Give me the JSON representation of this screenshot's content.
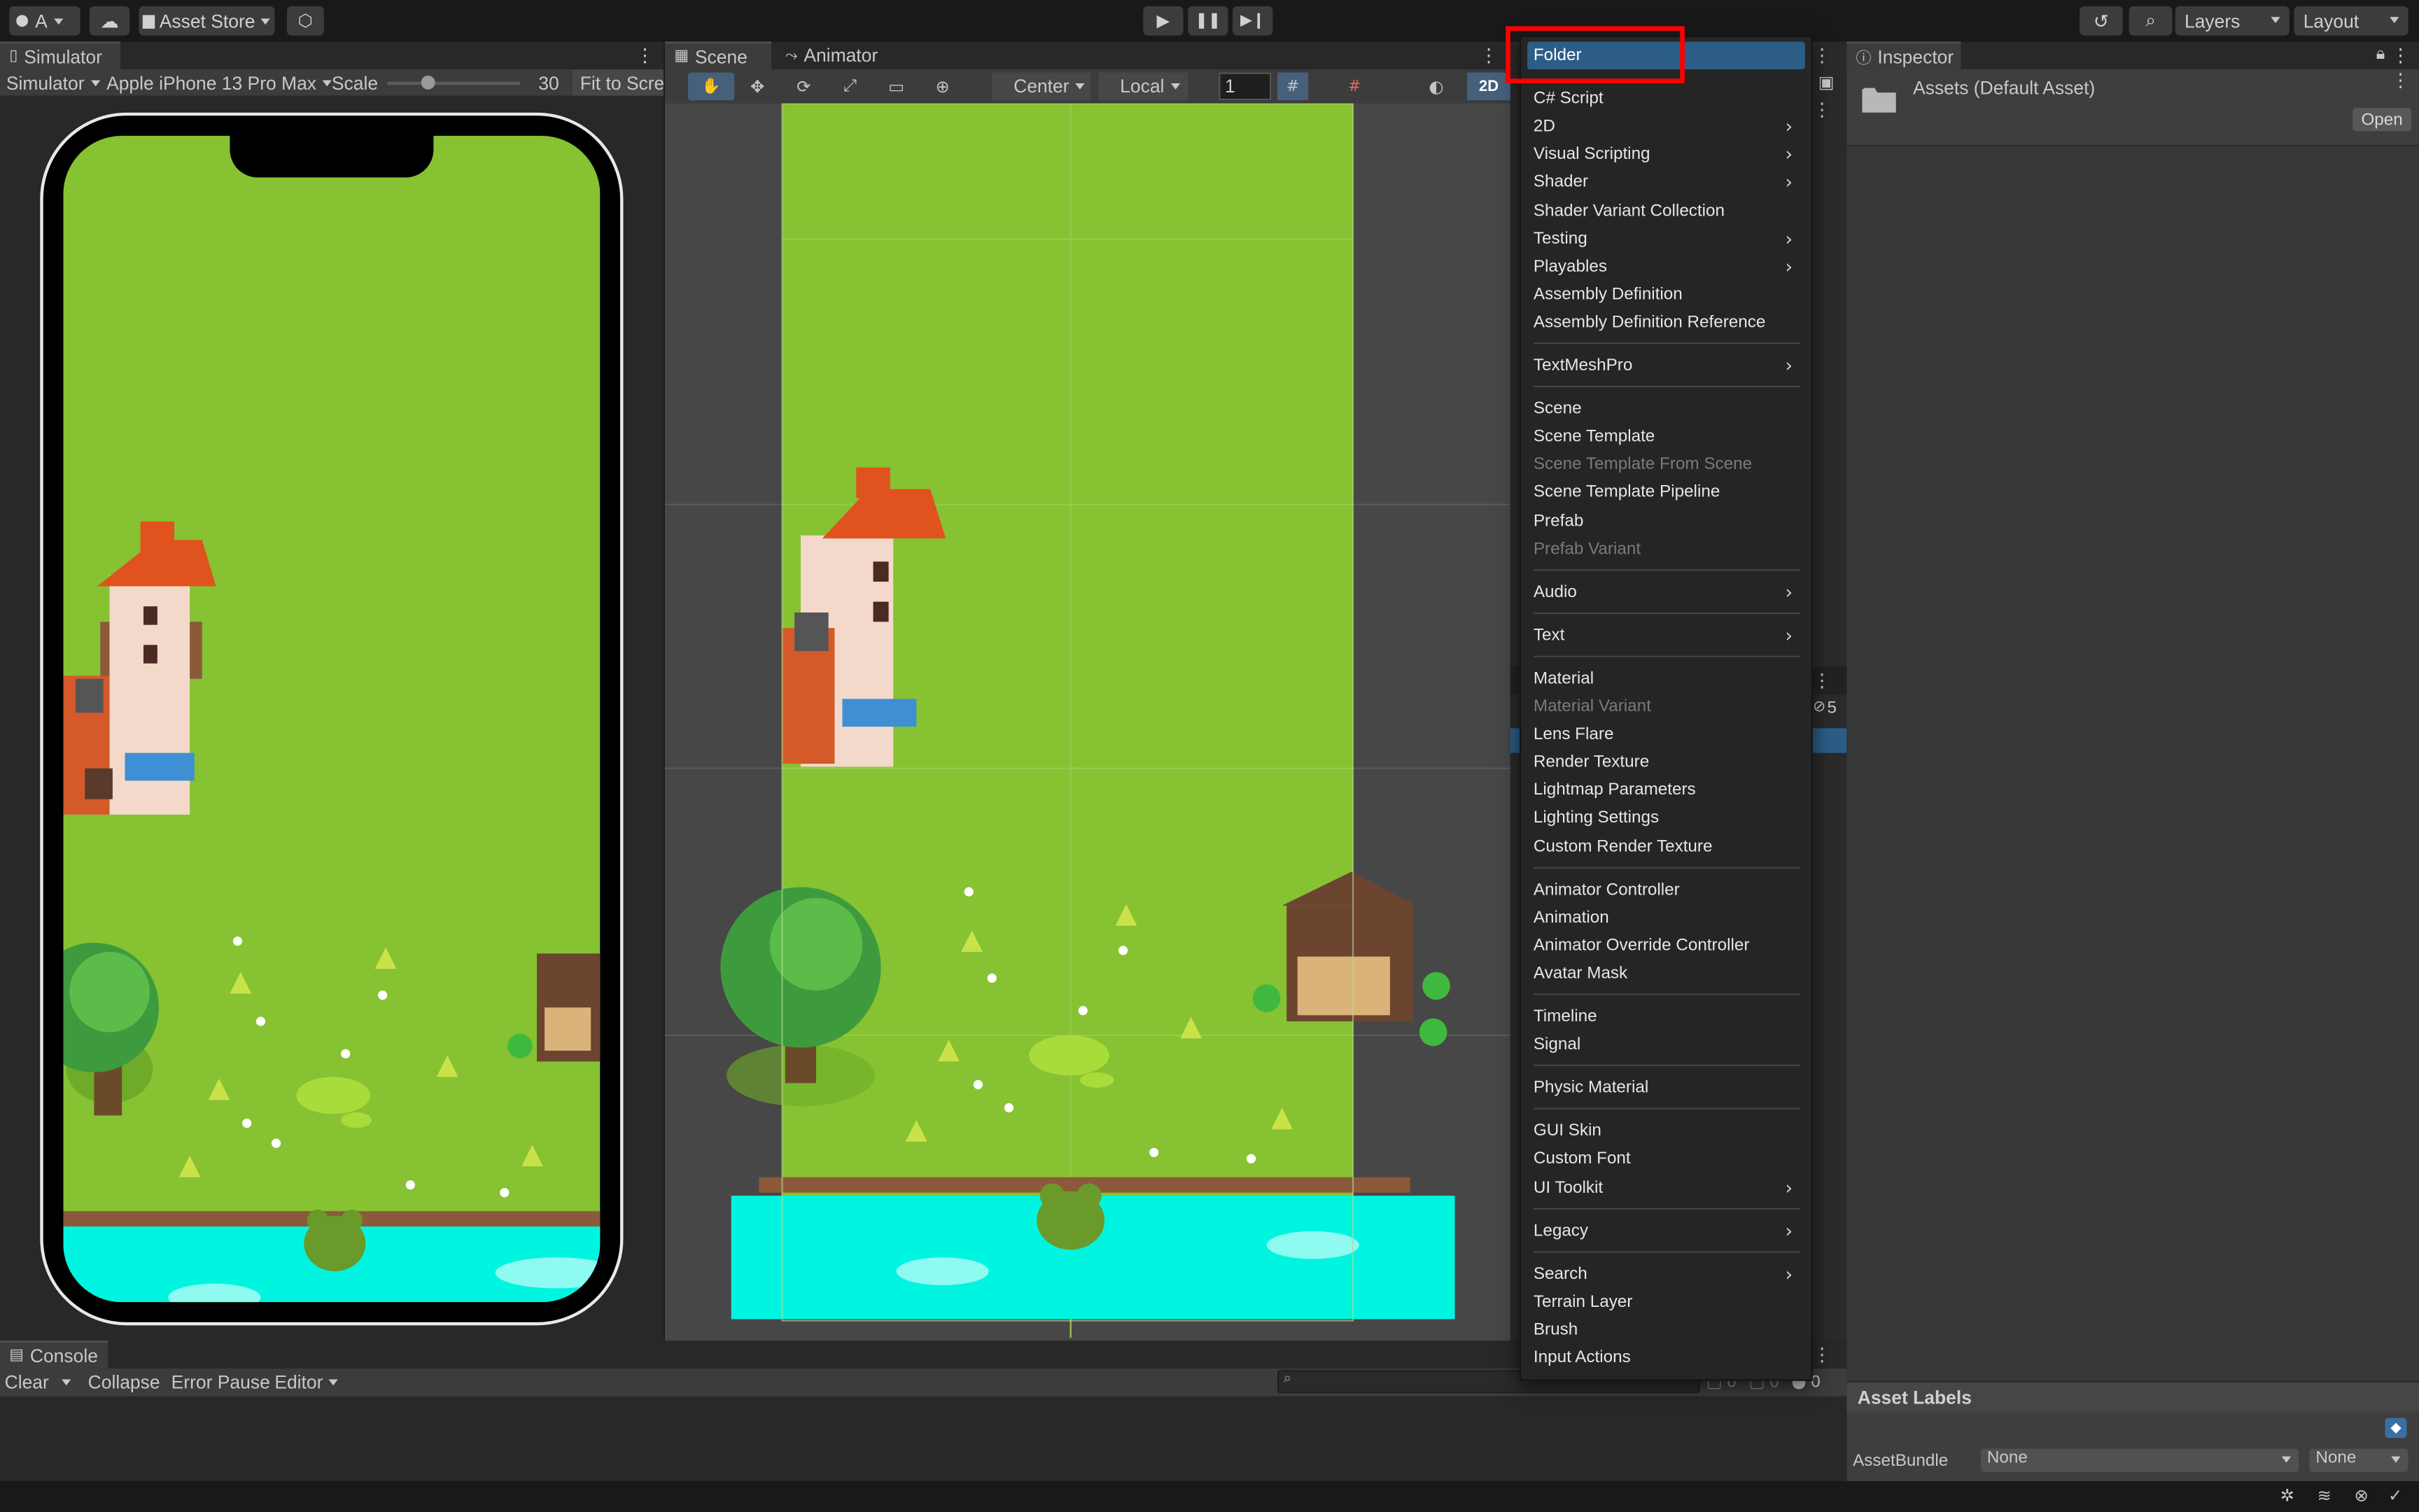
{
  "toolbar": {
    "account_label": "A",
    "asset_store_label": "Asset Store",
    "layers_label": "Layers",
    "layout_label": "Layout"
  },
  "simulator": {
    "tab_label": "Simulator",
    "mode_label": "Simulator",
    "device_label": "Apple iPhone 13 Pro Max",
    "scale_label": "Scale",
    "scale_value": "30",
    "scale_fraction": 0.3,
    "fit_label": "Fit to Scre"
  },
  "scene": {
    "tab_scene": "Scene",
    "tab_animator": "Animator",
    "pivot_label": "Center",
    "space_label": "Local",
    "snap_value": "1",
    "mode_2d": "2D"
  },
  "context_menu": {
    "items": [
      {
        "label": "Folder",
        "selected": true
      },
      {
        "label": "C# Script"
      },
      {
        "label": "2D",
        "submenu": true
      },
      {
        "label": "Visual Scripting",
        "submenu": true
      },
      {
        "label": "Shader",
        "submenu": true
      },
      {
        "label": "Shader Variant Collection"
      },
      {
        "label": "Testing",
        "submenu": true
      },
      {
        "label": "Playables",
        "submenu": true
      },
      {
        "label": "Assembly Definition"
      },
      {
        "label": "Assembly Definition Reference"
      },
      {
        "label": "TextMeshPro",
        "submenu": true
      },
      {
        "label": "Scene"
      },
      {
        "label": "Scene Template"
      },
      {
        "label": "Scene Template From Scene",
        "disabled": true
      },
      {
        "label": "Scene Template Pipeline"
      },
      {
        "label": "Prefab"
      },
      {
        "label": "Prefab Variant",
        "disabled": true
      },
      {
        "label": "Audio",
        "submenu": true
      },
      {
        "label": "Text",
        "submenu": true
      },
      {
        "label": "Material"
      },
      {
        "label": "Material Variant",
        "disabled": true
      },
      {
        "label": "Lens Flare"
      },
      {
        "label": "Render Texture"
      },
      {
        "label": "Lightmap Parameters"
      },
      {
        "label": "Lighting Settings"
      },
      {
        "label": "Custom Render Texture"
      },
      {
        "label": "Animator Controller"
      },
      {
        "label": "Animation"
      },
      {
        "label": "Animator Override Controller"
      },
      {
        "label": "Avatar Mask"
      },
      {
        "label": "Timeline"
      },
      {
        "label": "Signal"
      },
      {
        "label": "Physic Material"
      },
      {
        "label": "GUI Skin"
      },
      {
        "label": "Custom Font"
      },
      {
        "label": "UI Toolkit",
        "submenu": true
      },
      {
        "label": "Legacy",
        "submenu": true
      },
      {
        "label": "Search",
        "submenu": true
      },
      {
        "label": "Terrain Layer"
      },
      {
        "label": "Brush"
      },
      {
        "label": "Input Actions"
      }
    ]
  },
  "inspector": {
    "tab_label": "Inspector",
    "asset_title": "Assets (Default Asset)",
    "open_button": "Open",
    "asset_labels_header": "Asset Labels",
    "assetbundle_label": "AssetBundle",
    "assetbundle_value": "None",
    "variant_value": "None"
  },
  "hierarchy": {
    "hidden_count": "5"
  },
  "console": {
    "tab_label": "Console",
    "clear_label": "Clear",
    "collapse_label": "Collapse",
    "error_pause_label": "Error Pause",
    "editor_label": "Editor",
    "log_count": "0",
    "warn_count": "0",
    "error_count": "0"
  },
  "colors": {
    "grass": "#86c232",
    "water": "#00f5e1",
    "highlight": "#ff0000",
    "menu_selection": "#2c5d87"
  }
}
